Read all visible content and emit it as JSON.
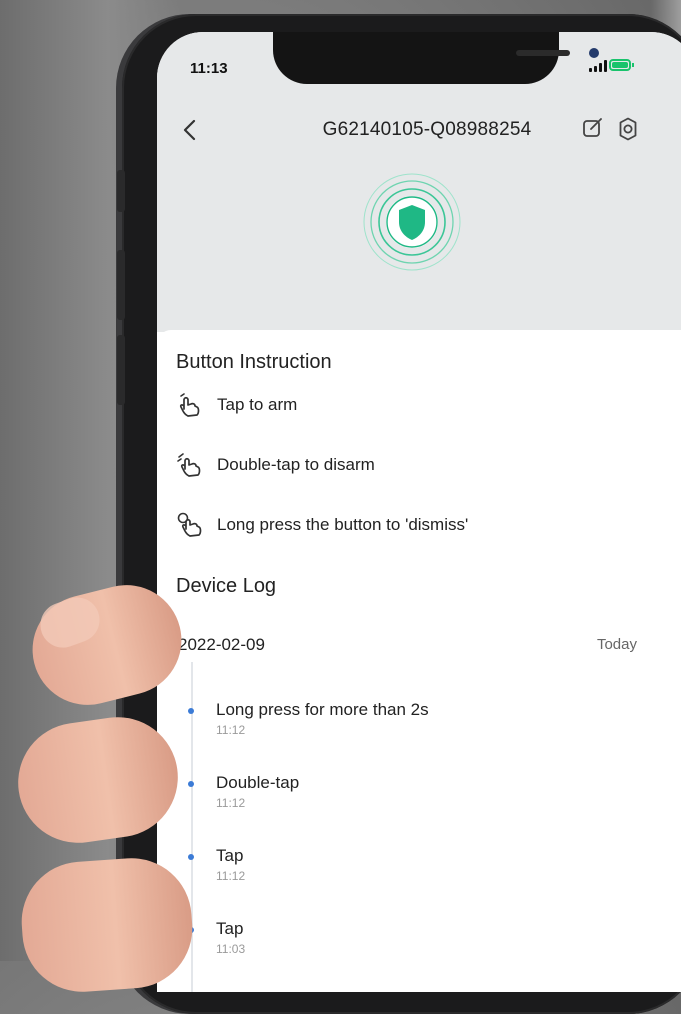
{
  "status_bar": {
    "time": "11:13"
  },
  "header": {
    "title": "G62140105-Q08988254"
  },
  "button_instruction": {
    "title": "Button Instruction",
    "items": [
      {
        "label": "Tap to arm",
        "icon": "tap-hand-icon"
      },
      {
        "label": "Double-tap to disarm",
        "icon": "double-tap-hand-icon"
      },
      {
        "label": "Long press the button to 'dismiss'",
        "icon": "long-press-hand-icon"
      }
    ]
  },
  "device_log": {
    "title": "Device Log",
    "date": "2022-02-09",
    "date_label": "Today",
    "entries": [
      {
        "event": "Long press for more than 2s",
        "time": "11:12"
      },
      {
        "event": "Double-tap",
        "time": "11:12"
      },
      {
        "event": "Tap",
        "time": "11:12"
      },
      {
        "event": "Tap",
        "time": "11:03"
      }
    ]
  },
  "colors": {
    "accent": "#1fb885",
    "timeline_dot": "#3b7bd6",
    "battery": "#19c36c"
  }
}
